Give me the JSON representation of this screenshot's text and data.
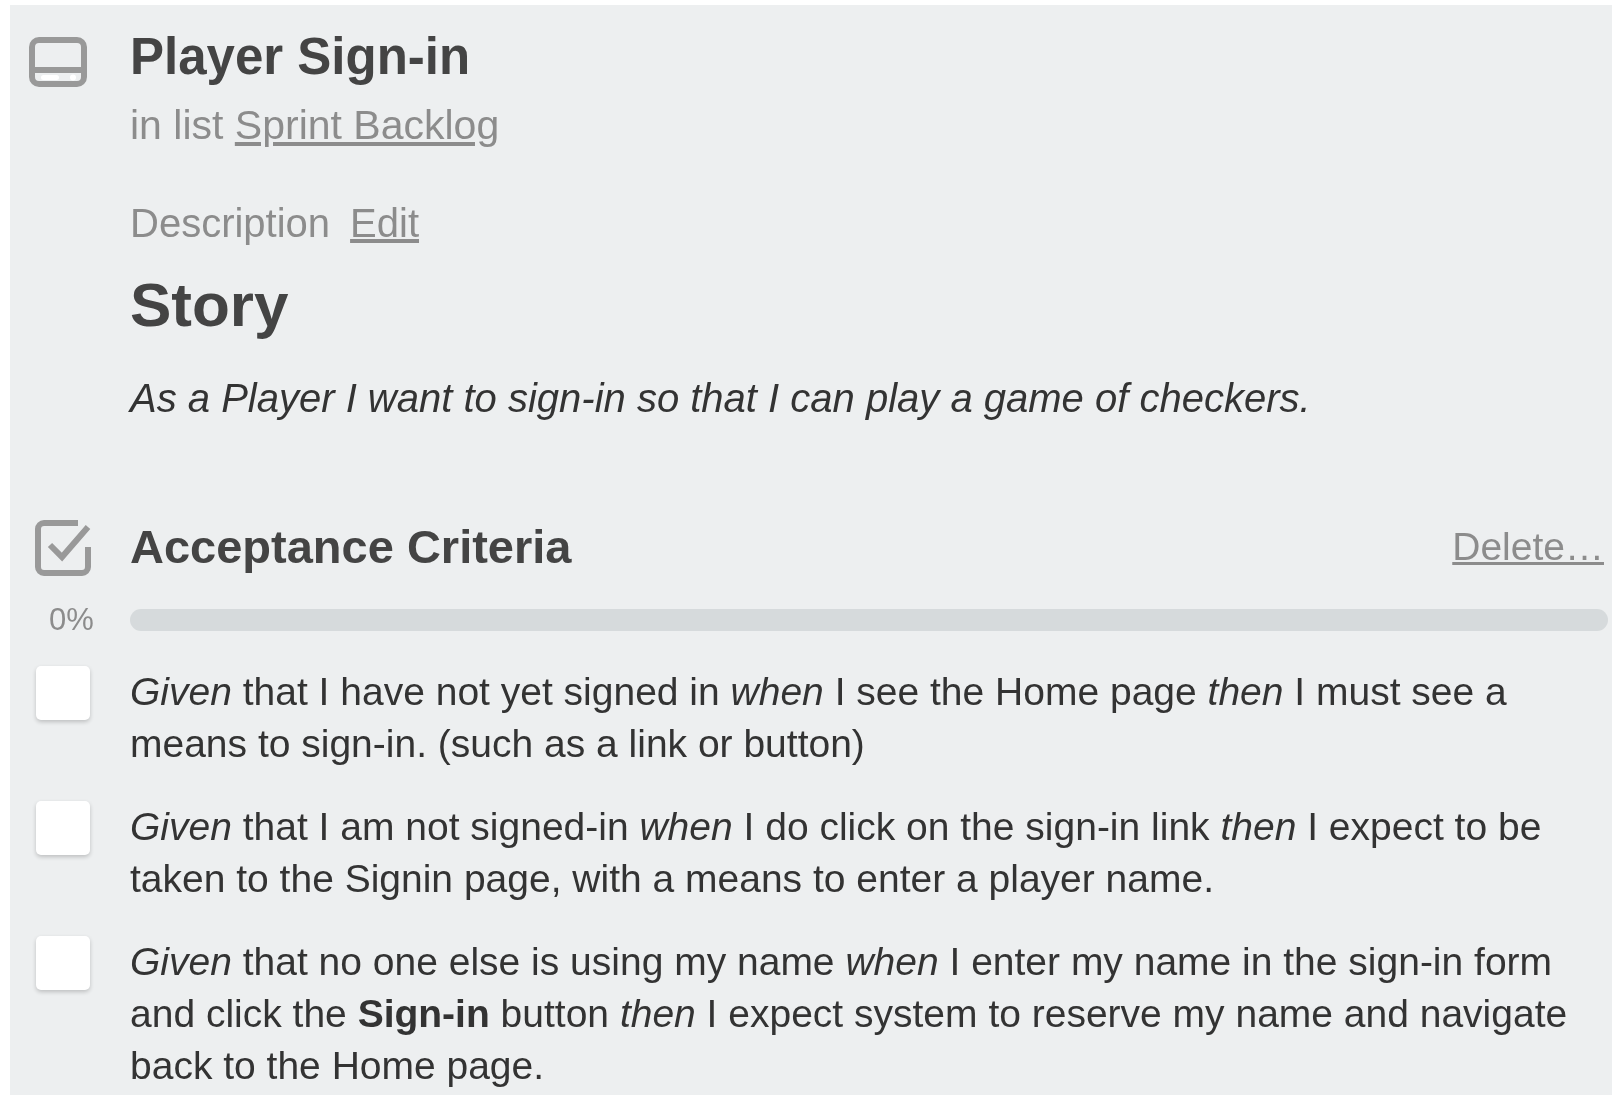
{
  "card": {
    "title": "Player Sign-in",
    "list_prefix": "in list",
    "list_name": "Sprint Backlog"
  },
  "description": {
    "label": "Description",
    "edit_link": "Edit",
    "heading": "Story",
    "story": "As a Player I want to sign-in so that I can play a game of checkers."
  },
  "checklist": {
    "title": "Acceptance Criteria",
    "delete_link": "Delete…",
    "percent": "0%",
    "level": 0,
    "items": [
      {
        "text": "*Given* that I have not yet signed in *when* I see the Home page *then* I must see a means to sign-in. (such as a link or button)",
        "checked": false
      },
      {
        "text": "*Given* that I am not signed-in *when* I do click on the sign-in link *then* I expect to be taken to the Signin page, with a means to enter a player name.",
        "checked": false
      },
      {
        "text": "*Given* that no one else is using my name *when* I enter my name in the sign-in form and click the **Sign-in** button *then* I expect system to reserve my name and navigate back to the Home page.",
        "checked": false
      }
    ]
  }
}
